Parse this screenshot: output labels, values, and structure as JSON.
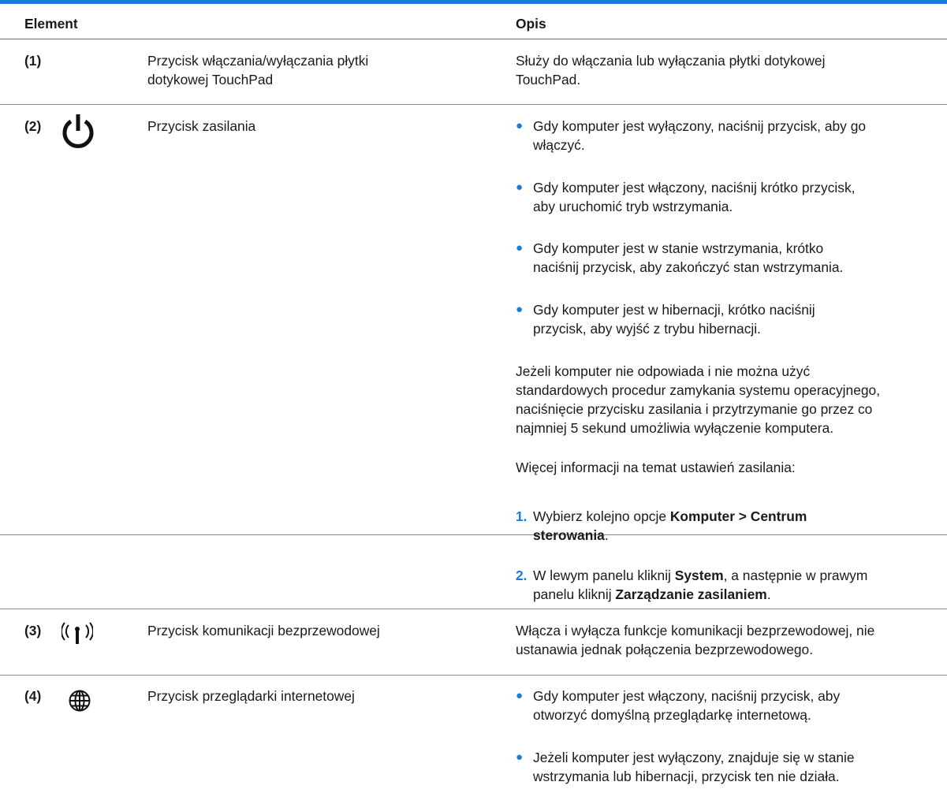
{
  "header": {
    "element": "Element",
    "opis": "Opis"
  },
  "rows": [
    {
      "num": "(1)",
      "name_l1": "Przycisk włączania/wyłączania płytki",
      "name_l2": "dotykowej TouchPad",
      "desc_l1": "Służy do włączania lub wyłączania płytki dotykowej",
      "desc_l2": "TouchPad."
    },
    {
      "num": "(2)",
      "icon": "power-icon",
      "name": "Przycisk zasilania",
      "bullets": [
        {
          "l1": "Gdy komputer jest wyłączony, naciśnij przycisk, aby go",
          "l2": "włączyć."
        },
        {
          "l1": "Gdy komputer jest włączony, naciśnij krótko przycisk,",
          "l2": "aby uruchomić tryb wstrzymania."
        },
        {
          "l1": "Gdy komputer jest w stanie wstrzymania, krótko",
          "l2": "naciśnij przycisk, aby zakończyć stan wstrzymania."
        },
        {
          "l1": "Gdy komputer jest w hibernacji, krótko naciśnij",
          "l2": "przycisk, aby wyjść z trybu hibernacji."
        }
      ],
      "para_lines": [
        "Jeżeli komputer nie odpowiada i nie można użyć",
        "standardowych procedur zamykania systemu operacyjnego,",
        "naciśnięcie przycisku zasilania i przytrzymanie go przez co",
        "najmniej 5 sekund umożliwia wyłączenie komputera."
      ],
      "more_info": "Więcej informacji na temat ustawień zasilania:",
      "steps": [
        {
          "n": "1.",
          "pre": "Wybierz kolejno opcje ",
          "bold1": "Komputer > Centrum",
          "bold2": "sterowania",
          "post": "."
        },
        {
          "n": "2.",
          "pre": "W lewym panelu kliknij ",
          "bold1": "System",
          "mid": ", a następnie w prawym",
          "pre2": "panelu kliknij ",
          "bold2": "Zarządzanie zasilaniem",
          "post": "."
        }
      ]
    },
    {
      "num": "(3)",
      "icon": "wireless-icon",
      "name": "Przycisk komunikacji bezprzewodowej",
      "desc_l1": "Włącza i wyłącza funkcje komunikacji bezprzewodowej, nie",
      "desc_l2": "ustanawia jednak połączenia bezprzewodowego."
    },
    {
      "num": "(4)",
      "icon": "globe-icon",
      "name": "Przycisk przeglądarki internetowej",
      "bullets": [
        {
          "l1": "Gdy komputer jest włączony, naciśnij przycisk, aby",
          "l2": "otworzyć domyślną przeglądarkę internetową."
        },
        {
          "l1": "Jeżeli komputer jest wyłączony, znajduje się w stanie",
          "l2": "wstrzymania lub hibernacji, przycisk ten nie działa."
        }
      ]
    }
  ],
  "colors": {
    "accent": "#1b7bd9",
    "text": "#1a1a1a"
  },
  "bullet_glyph": "●"
}
